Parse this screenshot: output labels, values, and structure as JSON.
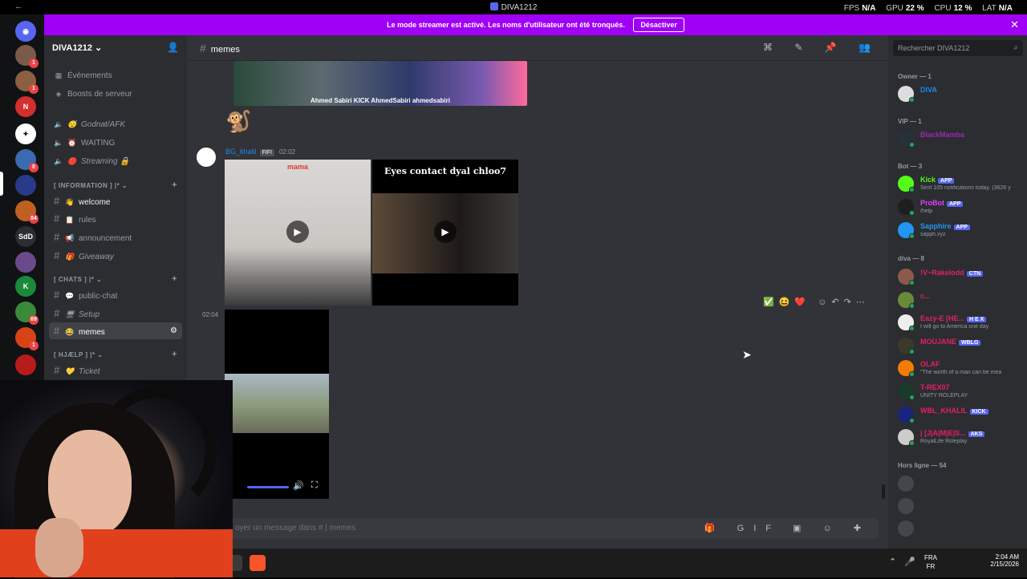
{
  "titlebar": {
    "title": "DIVA1212",
    "stats": [
      {
        "label": "FPS",
        "value": "N/A"
      },
      {
        "label": "GPU",
        "value": "22 %"
      },
      {
        "label": "CPU",
        "value": "12 %"
      },
      {
        "label": "LAT",
        "value": "N/A"
      }
    ]
  },
  "banner": {
    "text": "Le mode streamer est activé. Les noms d'utilisateur ont été tronqués.",
    "button": "Désactiver"
  },
  "server": {
    "name": "DIVA1212",
    "events": "Événements",
    "boosts": "Boosts de serveur"
  },
  "channels": {
    "voice": [
      "Godnat/AFK",
      "WAITING",
      "Streaming"
    ],
    "cat_info": "[ INFORMATION ] |*",
    "info": [
      "welcome",
      "rules",
      "announcement",
      "Giveaway"
    ],
    "cat_chats": "[ CHATS ] |*",
    "chats": [
      "public-chat",
      "Setup",
      "memes"
    ],
    "cat_help": "[ HJÆLP ] |*",
    "help": [
      "Ticket"
    ]
  },
  "chat": {
    "channel": "memes",
    "author": "BG_khalil",
    "author_tag": "FIFI",
    "time": "02:02",
    "stamp": "02:04",
    "media_caption": "Ahmed Sabiri   KICK AhmedSabiri   ahmedsabiri",
    "vid1_label": "mama",
    "vid2_label": "Eyes contact dyal chloo7",
    "composer_placeholder": "oyer un message dans #   |  memes"
  },
  "members": {
    "search_placeholder": "Rechercher DIVA1212",
    "groups": [
      {
        "label": "Owner — 1"
      },
      {
        "label": "VIP — 1"
      },
      {
        "label": "Bot — 3"
      },
      {
        "label": "diva — 8"
      },
      {
        "label": "Hors ligne — 54"
      }
    ],
    "owner": [
      {
        "name": "DIVA",
        "color": "#1e88e5"
      }
    ],
    "vip": [
      {
        "name": "BlackMamba",
        "color": "#9c27b0"
      }
    ],
    "bots": [
      {
        "name": "Kick",
        "tag": "APP",
        "sub": "Sent 105 notifications today. (3626 y",
        "color": "#53fc18"
      },
      {
        "name": "ProBot",
        "tag": "APP",
        "sub": "/help",
        "color": "#e040fb"
      },
      {
        "name": "Sapphire",
        "tag": "APP",
        "sub": "sapph.xyz",
        "color": "#2196f3"
      }
    ],
    "online": [
      {
        "name": "!V~Rakelodd",
        "tag": "CTN",
        "sub": "",
        "color": "#e91e63"
      },
      {
        "name": "c...",
        "tag": "",
        "sub": "",
        "color": "#e91e63"
      },
      {
        "name": "Eazy-E [HE...",
        "tag": "H E X",
        "sub": "I will go to America one day",
        "color": "#e91e63"
      },
      {
        "name": "MOUJANE",
        "tag": "WBLG",
        "sub": "",
        "color": "#e91e63"
      },
      {
        "name": "OLAF",
        "tag": "",
        "sub": "\"The worth of a man can be mea",
        "color": "#e91e63"
      },
      {
        "name": "T-REX07",
        "tag": "",
        "sub": "UNITY ROLEPLAY",
        "color": "#e91e63"
      },
      {
        "name": "WBL_KHALIL",
        "tag": "KICK",
        "sub": "",
        "color": "#e91e63"
      },
      {
        "name": "| [J|A|M|E|S...",
        "tag": "AKS",
        "sub": "RoyalLife Roleplay",
        "color": "#e91e63"
      }
    ]
  },
  "taskbar": {
    "time": "2:04 AM",
    "date": "2/15/2026",
    "lang1": "FRA",
    "lang2": "FR"
  },
  "colors": {
    "banner": "#a000f6",
    "accent": "#5865f2"
  }
}
